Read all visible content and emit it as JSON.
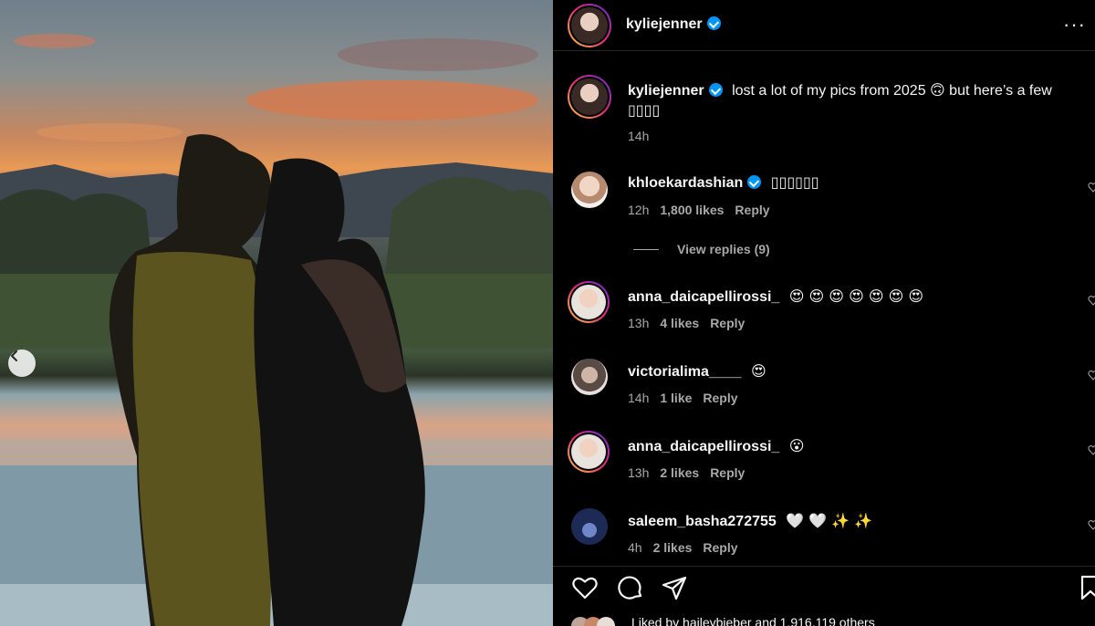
{
  "post": {
    "author": "kyliejenner",
    "more_label": "···",
    "caption_line1": "lost a lot of my pics from 2025 🙃 but here’s a few",
    "caption_line2": "▯▯▯▯",
    "caption_time": "14h"
  },
  "comments": [
    {
      "user": "khloekardashian",
      "verified": true,
      "text": "▯▯▯▯▯▯",
      "time": "12h",
      "likes": "1,800 likes",
      "reply": "Reply",
      "avatar_color": "#c9a48a"
    },
    {
      "user": "anna_daicapellirossi_",
      "verified": false,
      "text": "😍 😍 😍 😍 😍 😍 😍",
      "time": "13h",
      "likes": "4 likes",
      "reply": "Reply",
      "avatar_color": "#d8b7a5"
    },
    {
      "user": "victorialima____",
      "verified": false,
      "text": "😍",
      "time": "14h",
      "likes": "1 like",
      "reply": "Reply",
      "avatar_color": "#8a7f7a"
    },
    {
      "user": "anna_daicapellirossi_",
      "verified": false,
      "text": "😮",
      "time": "13h",
      "likes": "2 likes",
      "reply": "Reply",
      "avatar_color": "#d8b7a5"
    },
    {
      "user": "saleem_basha272755",
      "verified": false,
      "text": "🤍 🤍 ✨ ✨",
      "time": "4h",
      "likes": "2 likes",
      "reply": "Reply",
      "avatar_color": "#2b3b6e"
    }
  ],
  "view_replies": "View replies (9)",
  "likes_summary": "Liked by hailеybieber and 1,916,119 others",
  "icons": {
    "prev": "chevron-left-icon",
    "like": "heart-icon",
    "comment": "comment-icon",
    "share": "paper-plane-icon",
    "save": "bookmark-icon"
  },
  "colors": {
    "verified": "#0095f6",
    "background": "#000000",
    "muted": "#a8a8a8"
  }
}
